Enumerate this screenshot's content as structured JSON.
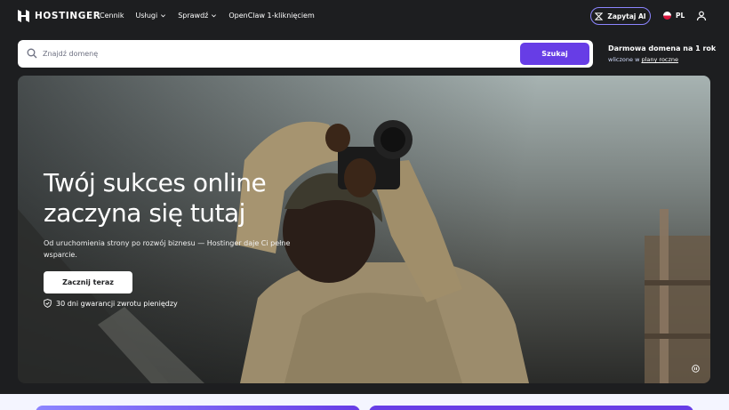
{
  "nav": {
    "logo_text": "HOSTINGER",
    "links": [
      {
        "label": "Cennik",
        "has_dropdown": false
      },
      {
        "label": "Usługi",
        "has_dropdown": true
      },
      {
        "label": "Sprawdź",
        "has_dropdown": true
      },
      {
        "label": "OpenClaw 1-kliknięciem",
        "has_dropdown": false
      }
    ],
    "ai_button": "Zapytaj AI",
    "language": "PL"
  },
  "search": {
    "placeholder": "Znajdź domenę",
    "button": "Szukaj"
  },
  "promo": {
    "title": "Darmowa domena na 1 rok",
    "subtitle_prefix": "wliczone w ",
    "subtitle_link": "plany roczne"
  },
  "hero": {
    "title_line1": "Twój sukces online",
    "title_line2": "zaczyna się tutaj",
    "description": "Od uruchomienia strony po rozwój biznesu — Hostinger daje Ci pełne wsparcie.",
    "cta": "Zacznij teraz",
    "guarantee": "30 dni gwarancji zwrotu pieniędzy"
  },
  "colors": {
    "background": "#1d1e20",
    "accent": "#673de6",
    "accent_light": "#8c85ff"
  },
  "icons": [
    "hostinger-logo-icon",
    "chevron-down-icon",
    "sparkle-ai-icon",
    "poland-flag-icon",
    "user-icon",
    "search-icon",
    "shield-check-icon",
    "pause-icon"
  ]
}
